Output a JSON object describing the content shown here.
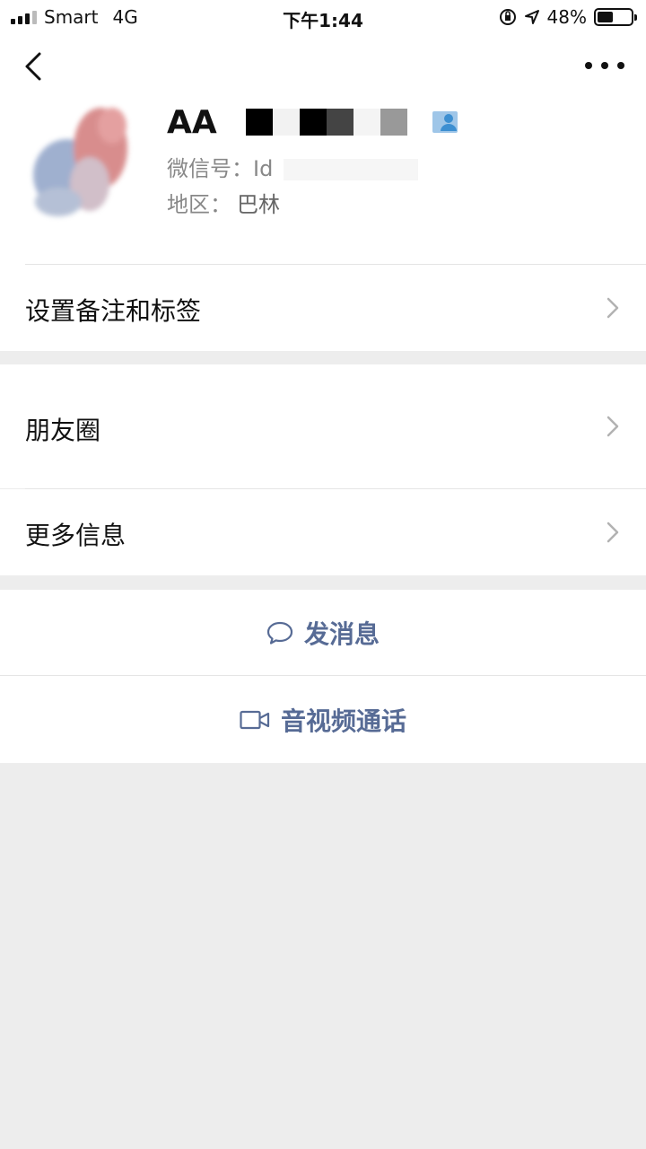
{
  "status_bar": {
    "carrier": "Smart",
    "network": "4G",
    "time": "下午1:44",
    "battery": "48%",
    "battery_level": 0.48
  },
  "profile": {
    "name": "AA",
    "wechat_id_label": "微信号：",
    "wechat_id_value": "Id",
    "region_label": "地区：",
    "region_value": "巴林"
  },
  "menu": {
    "remark_tags": "设置备注和标签",
    "moments": "朋友圈",
    "more_info": "更多信息"
  },
  "actions": {
    "send_message": "发消息",
    "video_call": "音视频通话"
  },
  "colors": {
    "accent_link": "#576b95",
    "background": "#ededed"
  },
  "icons": {
    "back": "chevron-left-icon",
    "more": "ellipsis-icon",
    "chevron": "chevron-right-icon",
    "message": "speech-bubble-icon",
    "video": "video-camera-icon",
    "contact": "contact-person-icon"
  }
}
